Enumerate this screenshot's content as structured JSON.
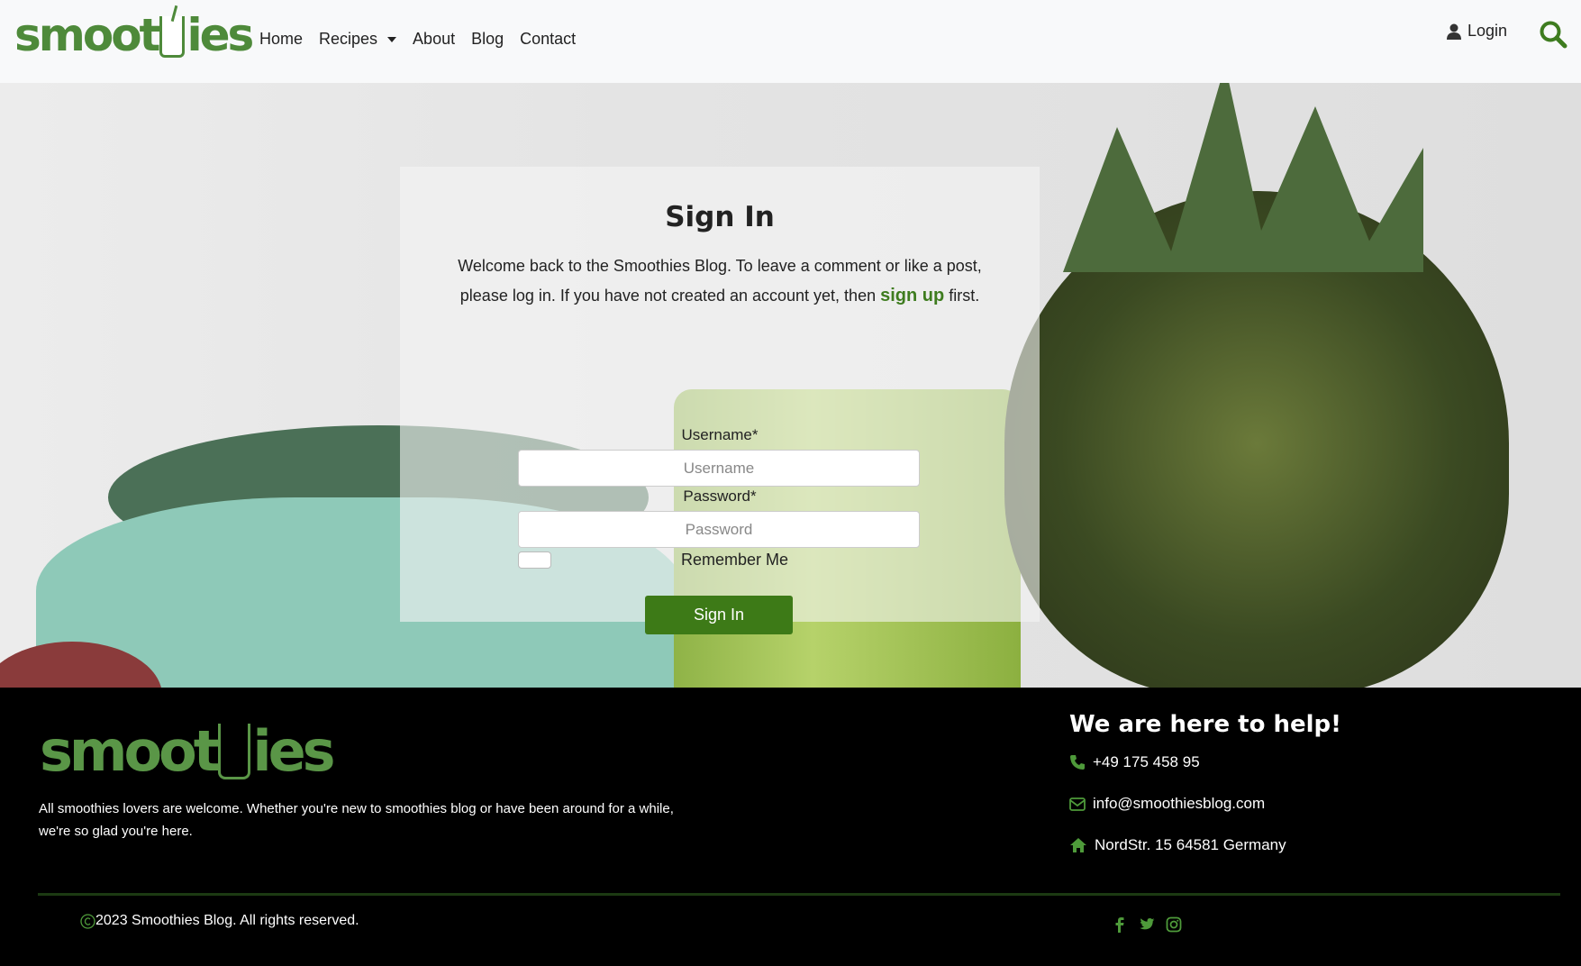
{
  "navbar": {
    "logo_text_a": "smoot",
    "logo_text_b": "ies",
    "links": [
      {
        "label": "Home"
      },
      {
        "label": "Recipes"
      },
      {
        "label": "About"
      },
      {
        "label": "Blog"
      },
      {
        "label": "Contact"
      }
    ],
    "login_label": "Login"
  },
  "signin": {
    "title": "Sign In",
    "intro_before": "Welcome back to the Smoothies Blog. To leave a comment or like a post, please log in. If you have not created an account yet, then ",
    "signup_label": "sign up",
    "intro_after": " first.",
    "username_label": "Username*",
    "username_placeholder": "Username",
    "password_label": "Password*",
    "password_placeholder": "Password",
    "remember_label": "Remember Me",
    "submit_label": "Sign In"
  },
  "footer": {
    "logo_text_a": "smoot",
    "logo_text_b": "ies",
    "description": "All smoothies lovers are welcome. Whether you're new to smoothies blog or have been around for a while, we're so glad you're here.",
    "help_title": "We are here to help!",
    "phone": "+49 175 458 95",
    "email": "info@smoothiesblog.com",
    "address": "NordStr. 15 64581 Germany",
    "copyright": "2023 Smoothies Blog. All rights reserved.",
    "socials": [
      "facebook-icon",
      "twitter-icon",
      "instagram-icon"
    ]
  },
  "colors": {
    "brand_green": "#4e8a3a",
    "button_green": "#3d7a17",
    "footer_bg": "#000000"
  }
}
